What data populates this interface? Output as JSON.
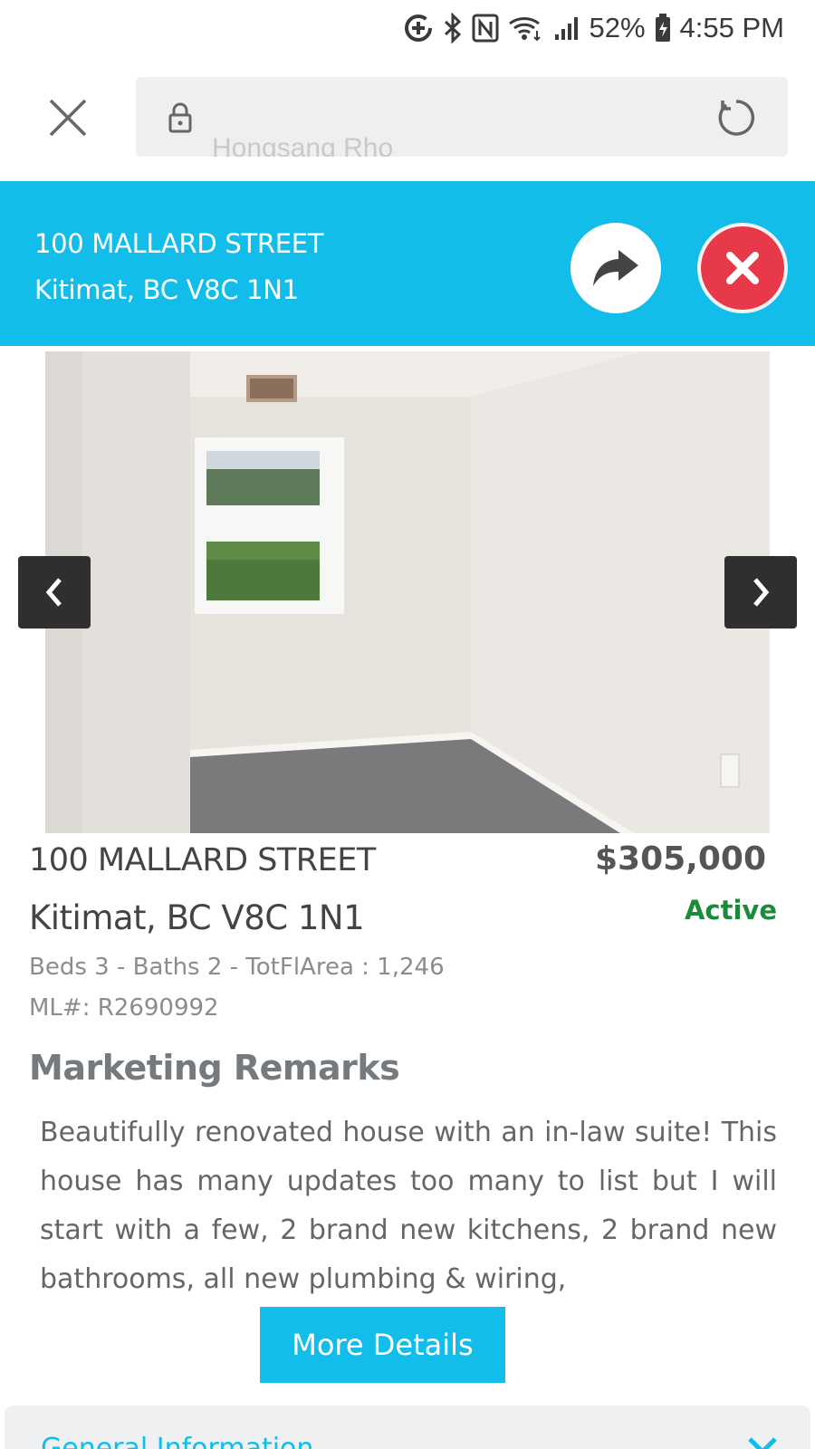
{
  "status_bar": {
    "battery": "52%",
    "time": "4:55 PM"
  },
  "browser": {
    "url_ghost_text": "Hongsang Rho"
  },
  "banner": {
    "address_line1": "100 MALLARD STREET",
    "address_line2": "Kitimat, BC V8C 1N1"
  },
  "listing": {
    "address_line1": "100 MALLARD STREET",
    "address_line2": "Kitimat, BC V8C 1N1",
    "price": "$305,000",
    "status": "Active",
    "specs": "Beds 3 - Baths 2 - TotFlArea : 1,246",
    "mls": "ML#: R2690992"
  },
  "remarks": {
    "title": "Marketing Remarks",
    "body": "Beautifully renovated house with an in-law suite! This house has many updates too many to list but I will start with a few, 2 brand new kitchens, 2 brand new bathrooms, all new plumbing & wiring,"
  },
  "actions": {
    "more_details": "More Details"
  },
  "accordion": {
    "label": "General Information"
  },
  "colors": {
    "accent": "#12bdea",
    "close_red": "#e8394a",
    "active_green": "#1b8a3a"
  }
}
